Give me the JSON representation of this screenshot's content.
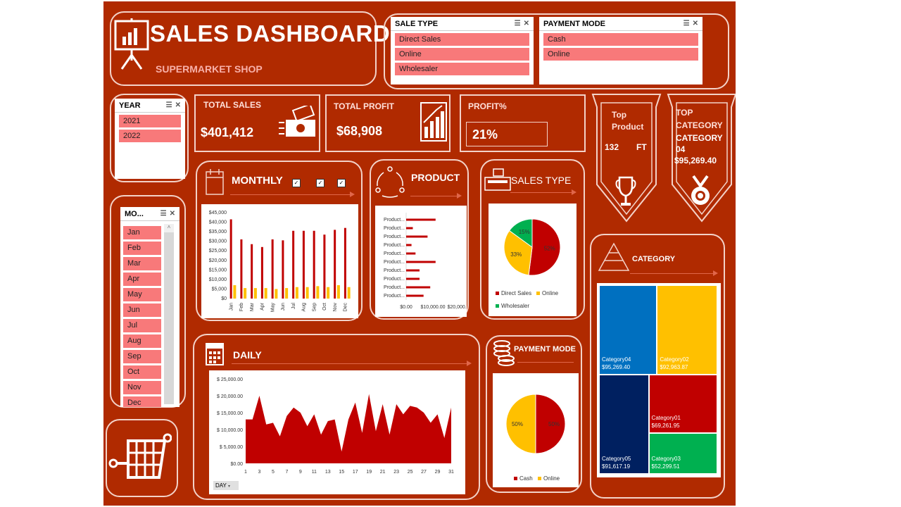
{
  "header": {
    "title": "SALES DASHBOARD",
    "subtitle": "SUPERMARKET SHOP"
  },
  "slicers": {
    "sale_type": {
      "title": "SALE TYPE",
      "items": [
        "Direct Sales",
        "Online",
        "Wholesaler"
      ]
    },
    "payment_mode": {
      "title": "PAYMENT MODE",
      "items": [
        "Cash",
        "Online"
      ]
    },
    "year": {
      "title": "YEAR",
      "items": [
        "2021",
        "2022"
      ]
    },
    "month": {
      "title": "MO...",
      "items": [
        "Jan",
        "Feb",
        "Mar",
        "Apr",
        "May",
        "Jun",
        "Jul",
        "Aug",
        "Sep",
        "Oct",
        "Nov",
        "Dec"
      ]
    }
  },
  "kpis": {
    "total_sales": {
      "label": "TOTAL SALES",
      "value": "$401,412"
    },
    "total_profit": {
      "label": "TOTAL PROFIT",
      "value": "$68,908"
    },
    "profit_pct": {
      "label": "PROFIT%",
      "value": "21%"
    }
  },
  "top_product": {
    "line1": "Top",
    "line2": "Product",
    "qty": "132",
    "unit": "FT"
  },
  "top_category": {
    "line1": "TOP",
    "line2": "CATEGORY",
    "line3": "CATEGORY",
    "line4": "04",
    "value": "$95,269.40"
  },
  "sections": {
    "monthly": "MONTHLY",
    "product": "PRODUCT",
    "sales_type": "SALES TYPE",
    "daily": "DAILY",
    "payment_mode": "PAYMENT MODE",
    "category": "CATEGORY",
    "day_button": "DAY"
  },
  "colors": {
    "background": "#b02a00",
    "slicer_item": "#f8797a",
    "bar_sales": "#c00000",
    "bar_profit": "#ffc000",
    "area": "#c00000"
  },
  "icons": [
    "presentation-board-icon",
    "cash-icon",
    "bar-growth-icon",
    "cycle-icon",
    "register-icon",
    "calendar-icon",
    "coins-icon",
    "pyramid-icon",
    "trophy-icon",
    "medal-icon",
    "cart-icon"
  ],
  "chart_data": [
    {
      "type": "bar",
      "title": "MONTHLY",
      "categories": [
        "Jan",
        "Feb",
        "Mar",
        "Apr",
        "May",
        "Jun",
        "Jul",
        "Aug",
        "Sep",
        "Oct",
        "Nov",
        "Dec"
      ],
      "series": [
        {
          "values": [
            41500,
            31000,
            28500,
            27000,
            31000,
            30500,
            35500,
            35500,
            35500,
            33500,
            36000,
            37000
          ]
        },
        {
          "values": [
            7000,
            5500,
            5500,
            5500,
            5000,
            5500,
            6000,
            6000,
            6500,
            6000,
            7000,
            6000
          ]
        }
      ],
      "yticks": [
        "$45,000",
        "$40,000",
        "$35,000",
        "$30,000",
        "$25,000",
        "$20,000",
        "$15,000",
        "$10,000",
        "$5,000",
        "$0"
      ],
      "ylim": [
        0,
        45000
      ]
    },
    {
      "type": "bar",
      "title": "PRODUCT",
      "orientation": "horizontal",
      "categories": [
        "Product...",
        "Product...",
        "Product...",
        "Product...",
        "Product...",
        "Product...",
        "Product...",
        "Product...",
        "Product...",
        "Product..."
      ],
      "values": [
        11000,
        2500,
        8000,
        2000,
        3500,
        11000,
        5000,
        5000,
        9000,
        6500
      ],
      "xticks": [
        "$0.00",
        "$10,000.00",
        "$20,000.00"
      ],
      "xlim": [
        0,
        20000
      ]
    },
    {
      "type": "pie",
      "title": "SALES TYPE",
      "labels": [
        "Direct Sales",
        "Online",
        "Wholesaler"
      ],
      "values": [
        52,
        33,
        15
      ],
      "slice_labels": [
        "52%",
        "33%",
        "15%"
      ],
      "legend": "bottom"
    },
    {
      "type": "area",
      "title": "DAILY",
      "x": [
        1,
        2,
        3,
        4,
        5,
        6,
        7,
        8,
        9,
        10,
        11,
        12,
        13,
        14,
        15,
        16,
        17,
        18,
        19,
        20,
        21,
        22,
        23,
        24,
        25,
        26,
        27,
        28,
        29,
        30,
        31
      ],
      "values": [
        13000,
        13000,
        20000,
        11500,
        12000,
        8000,
        14000,
        16500,
        15000,
        11000,
        14500,
        8500,
        12500,
        13000,
        3500,
        13000,
        18000,
        9000,
        20500,
        9500,
        17500,
        8500,
        17500,
        14500,
        17000,
        16500,
        15000,
        12000,
        14500,
        7500,
        16500
      ],
      "xticks": [
        "1",
        "3",
        "5",
        "7",
        "9",
        "11",
        "13",
        "15",
        "17",
        "19",
        "21",
        "23",
        "25",
        "27",
        "29",
        "31"
      ],
      "yticks": [
        "$ 25,000.00",
        "$ 20,000.00",
        "$ 15,000.00",
        "$ 10,000.00",
        "$ 5,000.00",
        "$0.00"
      ],
      "ylim": [
        0,
        25000
      ]
    },
    {
      "type": "pie",
      "title": "PAYMENT MODE",
      "labels": [
        "Cash",
        "Online"
      ],
      "values": [
        50,
        50
      ],
      "slice_labels": [
        "50%",
        "50%"
      ],
      "legend": "bottom"
    },
    {
      "type": "heatmap",
      "title": "CATEGORY",
      "subtype": "treemap",
      "items": [
        {
          "name": "Category04",
          "value": 95269.4,
          "label": "$95,269.40",
          "color": "#0070c0"
        },
        {
          "name": "Category02",
          "value": 92963.87,
          "label": "$92,963.87",
          "color": "#ffc000"
        },
        {
          "name": "Category05",
          "value": 91617.19,
          "label": "$91,617.19",
          "color": "#002060"
        },
        {
          "name": "Category01",
          "value": 69261.95,
          "label": "$69,261.95",
          "color": "#c00000"
        },
        {
          "name": "Category03",
          "value": 52299.51,
          "label": "$52,299.51",
          "color": "#00b050"
        }
      ]
    }
  ]
}
